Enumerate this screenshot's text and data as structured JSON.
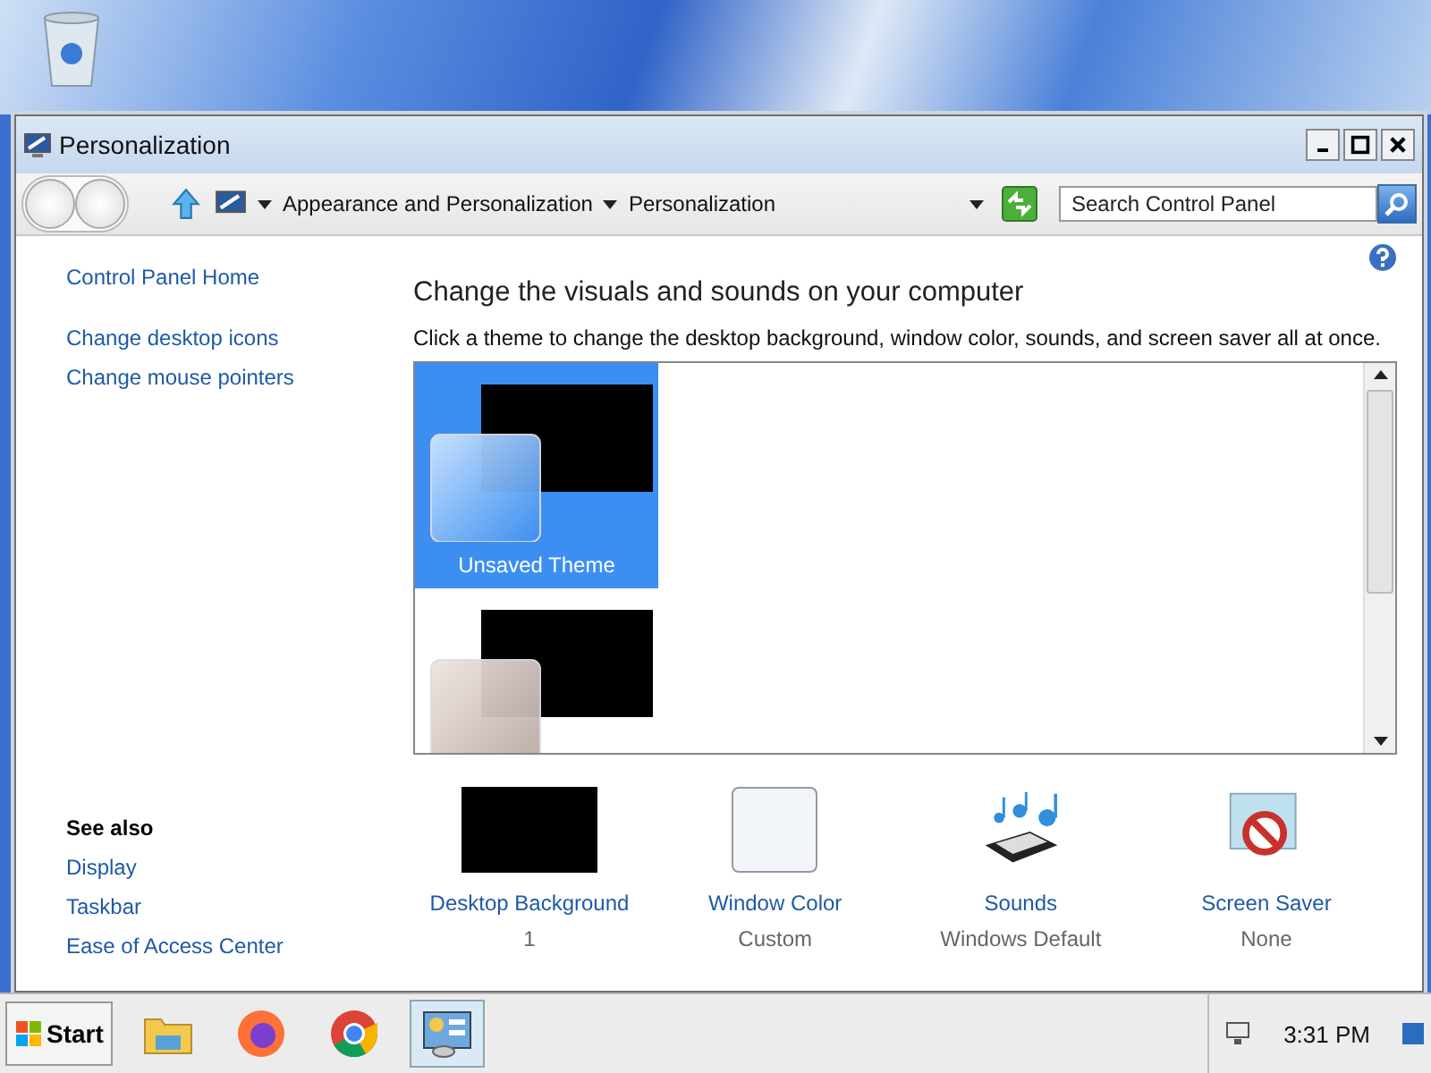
{
  "window": {
    "title": "Personalization"
  },
  "address_bar": {
    "segments": [
      "Appearance and Personalization",
      "Personalization"
    ]
  },
  "search": {
    "placeholder": "Search Control Panel"
  },
  "sidebar": {
    "links": [
      "Control Panel Home",
      "Change desktop icons",
      "Change mouse pointers"
    ],
    "see_also": {
      "heading": "See also",
      "links": [
        "Display",
        "Taskbar",
        "Ease of Access Center"
      ]
    }
  },
  "main": {
    "heading": "Change the visuals and sounds on your computer",
    "description": "Click a theme to change the desktop background, window color, sounds, and screen saver all at once.",
    "themes": [
      {
        "label": "Unsaved Theme",
        "selected": true,
        "kind": "blue"
      },
      {
        "selected": false,
        "kind": "gray"
      }
    ],
    "settings": [
      {
        "kind": "background",
        "label": "Desktop Background",
        "value": "1"
      },
      {
        "kind": "color",
        "label": "Window Color",
        "value": "Custom"
      },
      {
        "kind": "sounds",
        "label": "Sounds",
        "value": "Windows Default"
      },
      {
        "kind": "saver",
        "label": "Screen Saver",
        "value": "None"
      }
    ]
  },
  "taskbar": {
    "start": "Start",
    "apps": [
      {
        "kind": "folder",
        "selected": false
      },
      {
        "kind": "firefox",
        "selected": false
      },
      {
        "kind": "chrome",
        "selected": false
      },
      {
        "kind": "control",
        "selected": true
      }
    ],
    "clock": "3:31 PM"
  }
}
